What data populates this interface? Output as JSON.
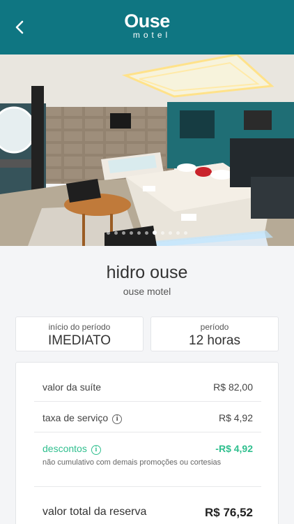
{
  "header": {
    "logo_name": "Ouse",
    "logo_sub": "motel",
    "back_icon": "chevron-left-icon"
  },
  "gallery": {
    "image_description": "suite photo with hot tub and round bed",
    "total_images": 11,
    "active_index": 6
  },
  "suite": {
    "name": "hidro ouse",
    "motel": "ouse motel"
  },
  "period": {
    "start_label": "início do período",
    "start_value": "IMEDIATO",
    "duration_label": "período",
    "duration_value": "12 horas"
  },
  "pricing": {
    "suite_label": "valor da suíte",
    "suite_value": "R$ 82,00",
    "fee_label": "taxa de serviço",
    "fee_value": "R$ 4,92",
    "discount_label": "descontos",
    "discount_value": "-R$ 4,92",
    "discount_note": "não cumulativo com demais promoções ou cortesias",
    "total_label": "valor total da reserva",
    "total_value": "R$ 76,52"
  },
  "colors": {
    "header": "#0f7682",
    "discount": "#2fbf8e",
    "background": "#f4f5f7"
  }
}
